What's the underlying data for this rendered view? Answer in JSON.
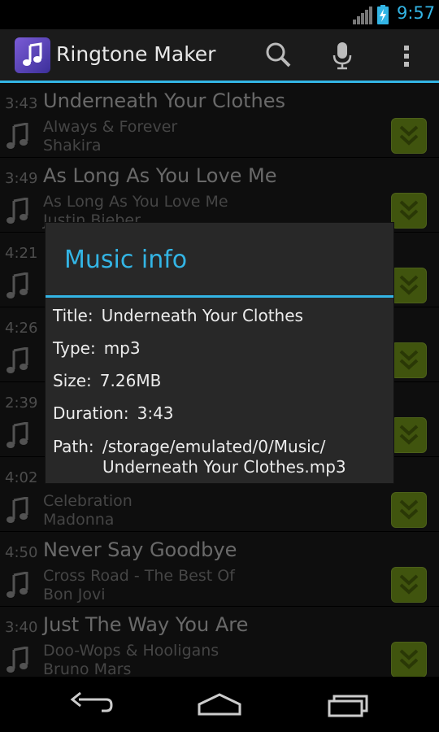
{
  "status_bar": {
    "time": "9:57",
    "icons": [
      "signal-icon",
      "battery-charging-icon"
    ]
  },
  "action_bar": {
    "title": "Ringtone Maker",
    "actions": [
      "search-icon",
      "microphone-icon",
      "overflow-menu-icon"
    ]
  },
  "songs": [
    {
      "duration": "3:43",
      "title": "Underneath Your Clothes",
      "album": "Always & Forever",
      "artist": "Shakira"
    },
    {
      "duration": "3:49",
      "title": "As Long As You Love Me",
      "album": "As Long As You Love Me",
      "artist": "Justin Bieber"
    },
    {
      "duration": "4:21",
      "title": "",
      "album": "",
      "artist": ""
    },
    {
      "duration": "4:26",
      "title": "",
      "album": "",
      "artist": ""
    },
    {
      "duration": "2:39",
      "title": "",
      "album": "",
      "artist": ""
    },
    {
      "duration": "4:02",
      "title": "",
      "album": "Celebration",
      "artist": "Madonna"
    },
    {
      "duration": "4:50",
      "title": "Never Say Goodbye",
      "album": "Cross Road - The Best Of",
      "artist": "Bon Jovi"
    },
    {
      "duration": "3:40",
      "title": "Just The Way You Are",
      "album": "Doo-Wops & Hooligans",
      "artist": "Bruno Mars"
    }
  ],
  "dialog": {
    "title": "Music info",
    "fields": {
      "title_label": "Title:",
      "title_value": "Underneath Your Clothes",
      "type_label": "Type:",
      "type_value": "mp3",
      "size_label": "Size:",
      "size_value": "7.26MB",
      "duration_label": "Duration:",
      "duration_value": "3:43",
      "path_label": "Path:",
      "path_value_line1": "/storage/emulated/0/Music/",
      "path_value_line2": "Underneath Your Clothes.mp3"
    }
  },
  "nav_bar": {
    "buttons": [
      "back-icon",
      "home-icon",
      "recent-apps-icon"
    ]
  },
  "colors": {
    "accent": "#33b5e5",
    "download_button": "#8fbb1f",
    "background": "#1f1f1f"
  }
}
